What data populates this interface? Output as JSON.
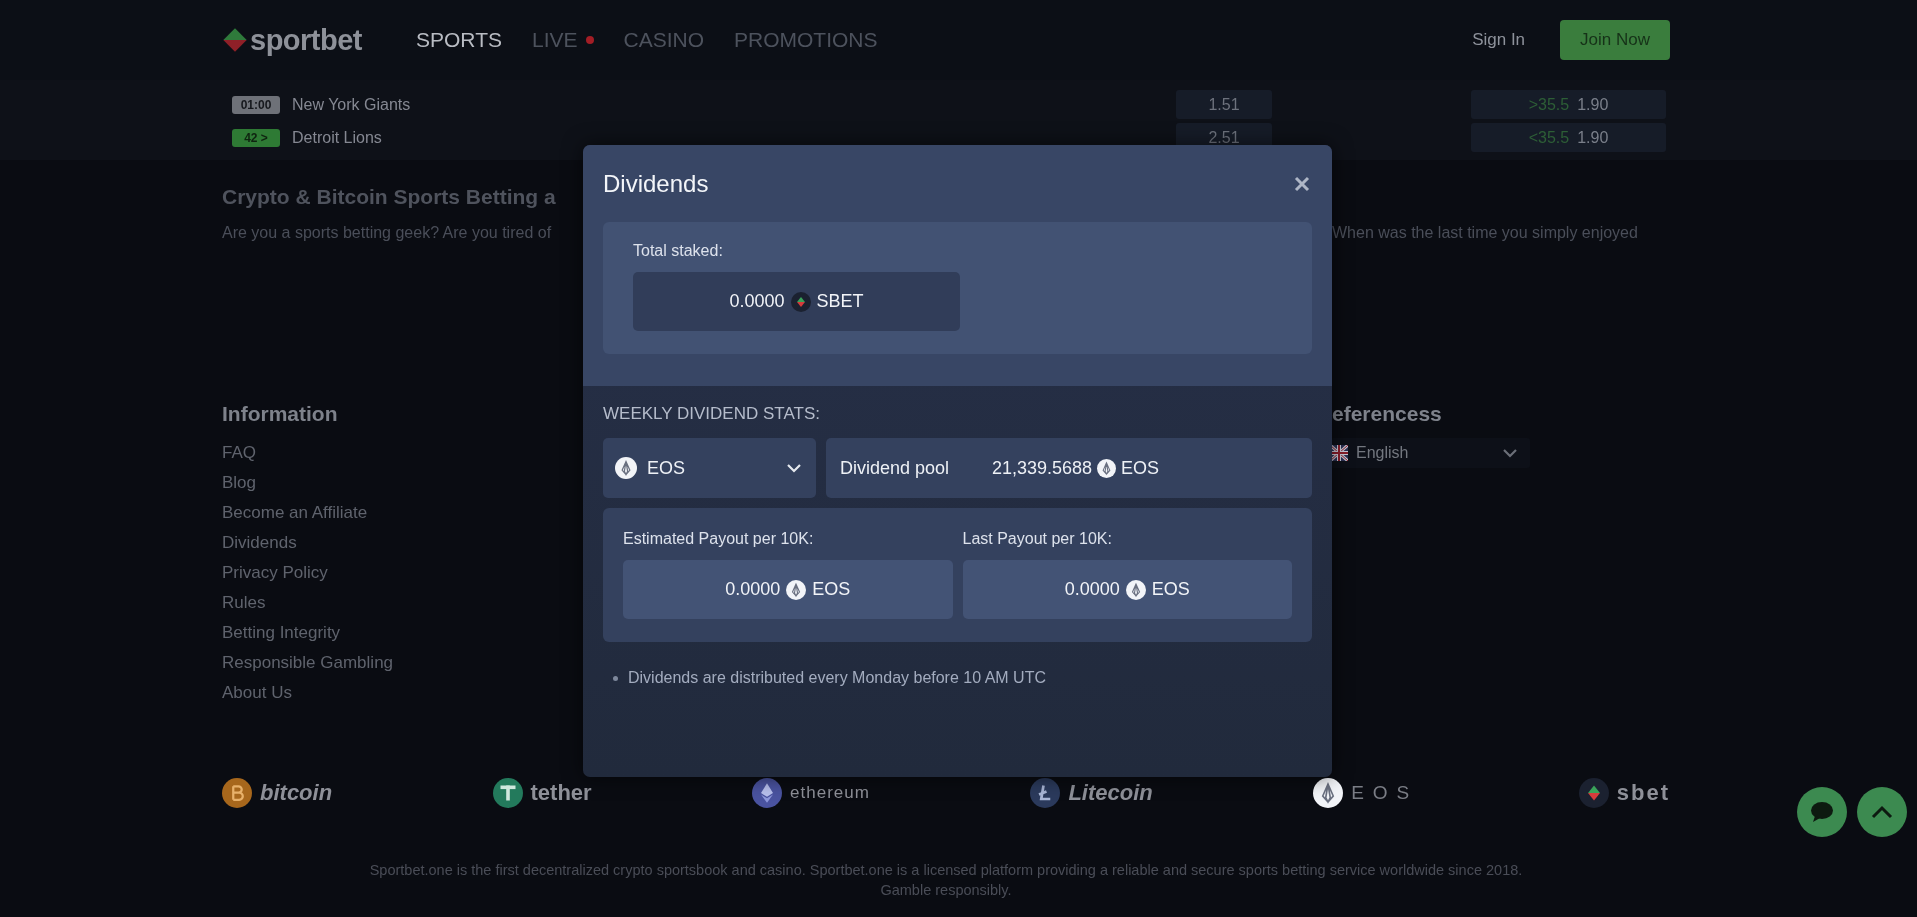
{
  "header": {
    "logo": "sportbet",
    "nav": [
      {
        "label": "SPORTS",
        "selected": true,
        "live_indicator": false
      },
      {
        "label": "LIVE",
        "selected": false,
        "live_indicator": true
      },
      {
        "label": "CASINO",
        "selected": false,
        "live_indicator": false
      },
      {
        "label": "PROMOTIONS",
        "selected": false,
        "live_indicator": false
      }
    ],
    "sign_in": "Sign In",
    "join": "Join Now"
  },
  "matches": [
    {
      "kind": "scheduled",
      "badge": "01:00",
      "team": "New York Giants",
      "odds": "1.51",
      "total_line": ">35.5",
      "total_odds": "1.90"
    },
    {
      "kind": "live",
      "badge": "42 >",
      "team": "Detroit Lions",
      "odds": "2.51",
      "total_line": "<35.5",
      "total_odds": "1.90"
    }
  ],
  "article": {
    "heading": "Crypto & Bitcoin Sports Betting a",
    "text_left": "Are you a sports betting geek? Are you tired of",
    "text_right": "When was the last time you simply enjoyed"
  },
  "footer": {
    "information": {
      "title": "Information",
      "links": [
        "FAQ",
        "Blog",
        "Become an Affiliate",
        "Dividends",
        "Privacy Policy",
        "Rules",
        "Betting Integrity",
        "Responsible Gambling",
        "About Us"
      ]
    },
    "preferences": {
      "title": "eferencess",
      "language": "English"
    }
  },
  "cryptos": [
    {
      "kind": "bitcoin",
      "name": "bitcoin"
    },
    {
      "kind": "tether",
      "name": "tether"
    },
    {
      "kind": "ethereum",
      "name": "ethereum"
    },
    {
      "kind": "litecoin",
      "name": "Litecoin"
    },
    {
      "kind": "eos",
      "name": "EOS"
    },
    {
      "kind": "sbet",
      "name": "sbet"
    }
  ],
  "disclaimer": [
    "Sportbet.one is the first decentralized crypto sportsbook and casino. Sportbet.one is a licensed platform providing a reliable and secure sports betting service worldwide since 2018.",
    "Gamble responsibly."
  ],
  "modal": {
    "title": "Dividends",
    "total_staked": {
      "label": "Total staked:",
      "value": "0.0000",
      "unit": "SBET"
    },
    "stats_title": "WEEKLY DIVIDEND STATS:",
    "currency_select": {
      "value": "EOS"
    },
    "pool": {
      "label": "Dividend pool",
      "value": "21,339.5688",
      "unit": "EOS"
    },
    "payouts": [
      {
        "label": "Estimated Payout per 10K:",
        "value": "0.0000",
        "unit": "EOS"
      },
      {
        "label": "Last Payout per 10K:",
        "value": "0.0000",
        "unit": "EOS"
      }
    ],
    "note": "Dividends are distributed every Monday before 10 AM UTC"
  }
}
